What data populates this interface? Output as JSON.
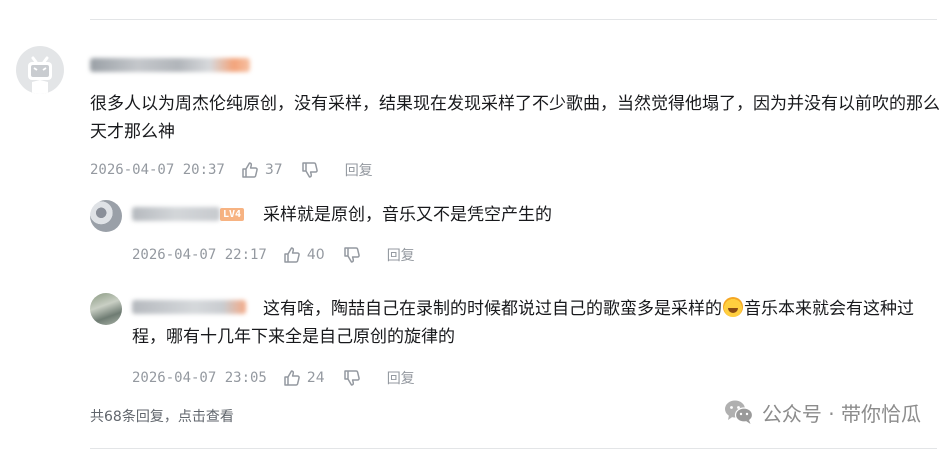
{
  "main_comment": {
    "username": "",
    "text": "很多人以为周杰伦纯原创，没有采样，结果现在发现采样了不少歌曲，当然觉得他塌了，因为并没有以前吹的那么天才那么神",
    "time": "2026-04-07 20:37",
    "likes": "37",
    "reply_label": "回复",
    "avatar_icon": "bilibili-tv-icon"
  },
  "replies": [
    {
      "level_badge": "LV4",
      "text": "采样就是原创，音乐又不是凭空产生的",
      "time": "2026-04-07 22:17",
      "likes": "40",
      "reply_label": "回复"
    },
    {
      "text_before_emoji": "这有啥，陶喆自己在录制的时候都说过自己的歌蛮多是采样的",
      "emoji": "laughing-tears-emoji",
      "text_after_emoji": "音乐本来就会有这种过程，哪有十几年下来全是自己原创的旋律的",
      "time": "2026-04-07 23:05",
      "likes": "24",
      "reply_label": "回复"
    }
  ],
  "view_more": "共68条回复，点击查看",
  "watermark": {
    "text": "公众号 · 带你恰瓜",
    "icon": "wechat-icon"
  },
  "colors": {
    "text": "#18191c",
    "meta": "#9499a0",
    "divider": "#e3e5e7",
    "level_badge": "#f6a66d"
  }
}
